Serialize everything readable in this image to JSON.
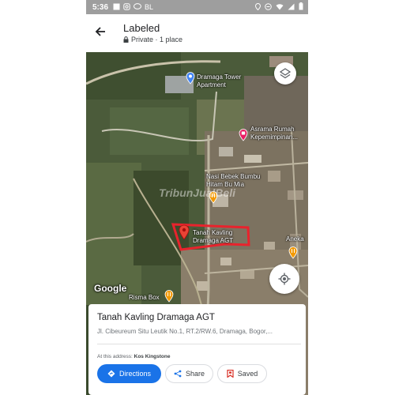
{
  "status_bar": {
    "time": "5:36",
    "icons_left": [
      "photo-icon",
      "instagram-icon",
      "chat-icon"
    ],
    "carrier_text": "BL",
    "icons_right": [
      "location-icon",
      "dnd-icon",
      "wifi-icon",
      "signal-icon",
      "battery-icon"
    ]
  },
  "header": {
    "title": "Labeled",
    "subtitle": "Private · 1 place"
  },
  "map": {
    "labels": {
      "tower": "Dramaga Tower Apartment",
      "asrama": "Asrama Rumah Kepemimpinan...",
      "nasi": "Nasi Bebek Bumbu Hitam Bu Mia",
      "tanah": "Tanah Kavling Dramaga AGT",
      "aneka": "Aneka",
      "risma": "Risma Box"
    },
    "watermark": "TribunJualBeli",
    "google_logo": "Google"
  },
  "place_card": {
    "name": "Tanah Kavling Dramaga AGT",
    "address": "Jl. Cibeureum Situ Leutik No.1, RT.2/RW.6, Dramaga, Bogor,...",
    "at_address_label": "At this address:",
    "at_address_value": "Kos Kingstone",
    "buttons": {
      "directions": "Directions",
      "share": "Share",
      "saved": "Saved"
    }
  },
  "colors": {
    "accent": "#1a73e8",
    "status_bar": "#9e9e9e",
    "saved_icon": "#d93025",
    "pin_red": "#ea4335",
    "pin_orange": "#f29900",
    "pin_pink": "#e91e63",
    "highlight_outline": "#e8232d"
  }
}
